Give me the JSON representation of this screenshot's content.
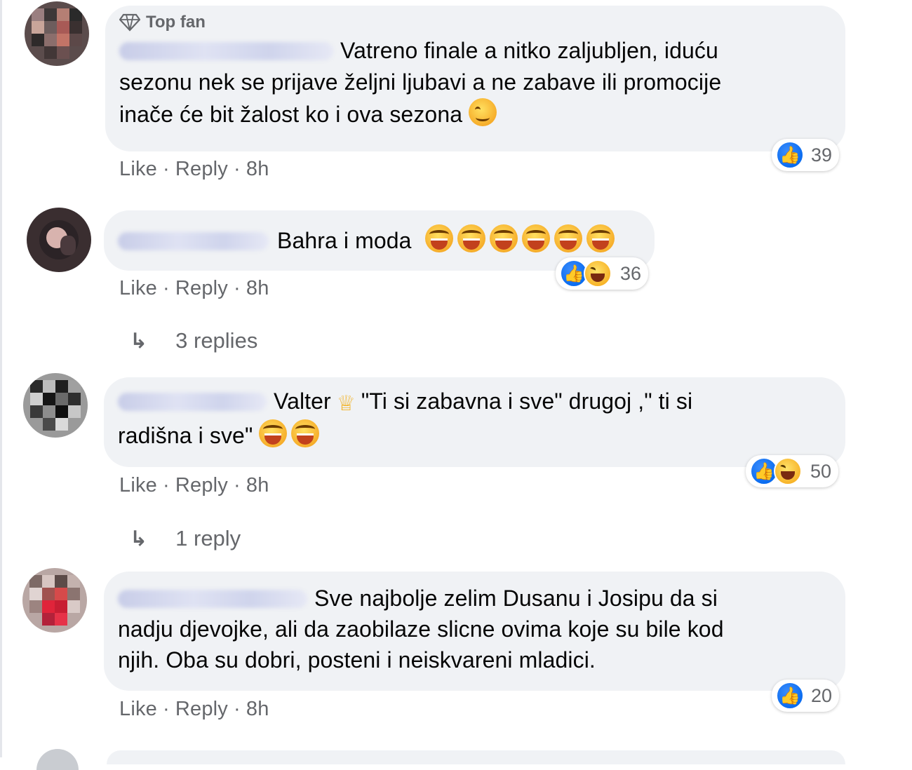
{
  "comments": [
    {
      "badge": "Top fan",
      "text_lines": [
        "Vatreno finale a nitko zaljubljen, iduću",
        "sezonu nek se prijave željni ljubavi a ne zabave ili promocije",
        "inače će bit žalost ko i ova sezona"
      ],
      "reaction_count": "39",
      "actions": {
        "like": "Like",
        "reply": "Reply",
        "time": "8h"
      }
    },
    {
      "text": "Bahra i moda",
      "reaction_count": "36",
      "actions": {
        "like": "Like",
        "reply": "Reply",
        "time": "8h"
      },
      "replies_label": "3 replies"
    },
    {
      "text_line1_a": "Valter",
      "text_line1_b": "\"Ti si zabavna i sve\" drugoj ,\" ti si",
      "text_line2": "radišna i sve\"",
      "reaction_count": "50",
      "actions": {
        "like": "Like",
        "reply": "Reply",
        "time": "8h"
      },
      "replies_label": "1 reply"
    },
    {
      "text_lines": [
        "Sve najbolje zelim Dusanu i Josipu da si",
        "nadju djevojke, ali da zaobilaze slicne ovima koje su bile kod",
        "njih. Oba su dobri, posteni i neiskvareni mladici."
      ],
      "reaction_count": "20",
      "actions": {
        "like": "Like",
        "reply": "Reply",
        "time": "8h"
      }
    }
  ],
  "separator": "·",
  "icons": {
    "like": "like-reaction-icon",
    "haha": "haha-reaction-icon",
    "reply_arrow": "reply-arrow-icon",
    "top_fan": "diamond-icon"
  }
}
